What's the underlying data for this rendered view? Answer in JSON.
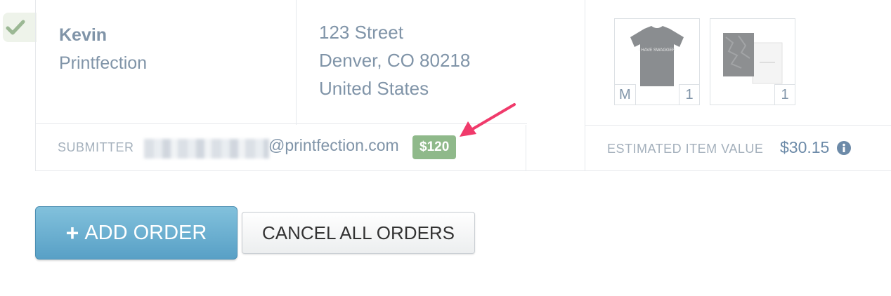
{
  "recipient": {
    "first_name": "Kevin",
    "company": "Printfection"
  },
  "address": {
    "line1": "123 Street",
    "line2": "Denver, CO 80218",
    "line3": "United States"
  },
  "products": [
    {
      "name": "t-shirt",
      "shirt_text": "I HAVE SWAGGER",
      "size": "M",
      "quantity": "1"
    },
    {
      "name": "notebook",
      "quantity": "1"
    }
  ],
  "submitter": {
    "label": "SUBMITTER",
    "email_domain": "@printfection.com",
    "price": "$120"
  },
  "estimate": {
    "label": "ESTIMATED ITEM VALUE",
    "value": "$30.15"
  },
  "actions": {
    "add_order_label": "ADD ORDER",
    "add_order_icon": "+",
    "cancel_all_label": "CANCEL ALL ORDERS"
  },
  "colors": {
    "accent_blue": "#5ea6cb",
    "price_green": "#8fb98a",
    "annotation_arrow": "#f03a6b",
    "text_muted": "#8094a8"
  }
}
